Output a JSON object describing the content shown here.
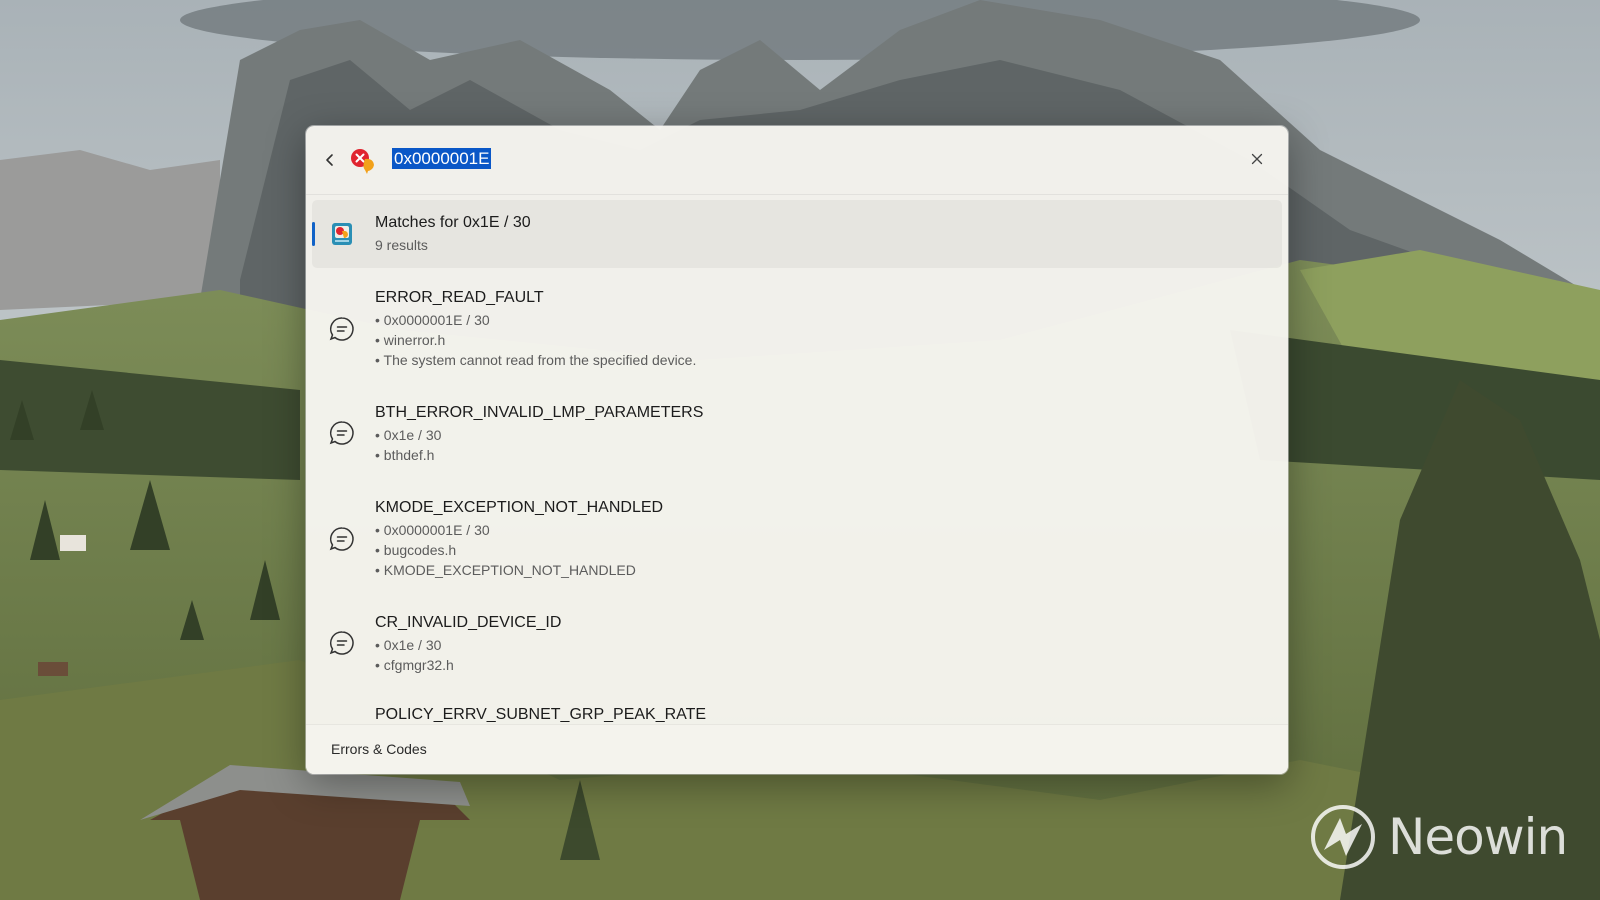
{
  "search": {
    "query": "0x0000001E",
    "back_icon": "chevron-left-icon",
    "plugin_icon": "error-codes-plugin-icon",
    "close_icon": "close-icon"
  },
  "results": [
    {
      "title": "Matches for 0x1E / 30",
      "lines": [
        "9 results"
      ],
      "icon": "errors-codes-app-icon",
      "selected": true
    },
    {
      "title": "ERROR_READ_FAULT",
      "lines": [
        "• 0x0000001E / 30",
        "• winerror.h",
        "• The system cannot read from the specified device."
      ],
      "icon": "chat-bubble-icon"
    },
    {
      "title": "BTH_ERROR_INVALID_LMP_PARAMETERS",
      "lines": [
        "• 0x1e / 30",
        "• bthdef.h"
      ],
      "icon": "chat-bubble-icon"
    },
    {
      "title": "KMODE_EXCEPTION_NOT_HANDLED",
      "lines": [
        "• 0x0000001E / 30",
        "• bugcodes.h",
        "• KMODE_EXCEPTION_NOT_HANDLED"
      ],
      "icon": "chat-bubble-icon"
    },
    {
      "title": "CR_INVALID_DEVICE_ID",
      "lines": [
        "• 0x1e / 30",
        "• cfgmgr32.h"
      ],
      "icon": "chat-bubble-icon"
    },
    {
      "title": "POLICY_ERRV_SUBNET_GRP_PEAK_RATE",
      "lines": [],
      "icon": "chat-bubble-icon"
    }
  ],
  "footer": {
    "label": "Errors & Codes"
  },
  "watermark": {
    "text": "Neowin"
  },
  "colors": {
    "selection": "#0a57c7",
    "accent": "#1062c7"
  }
}
